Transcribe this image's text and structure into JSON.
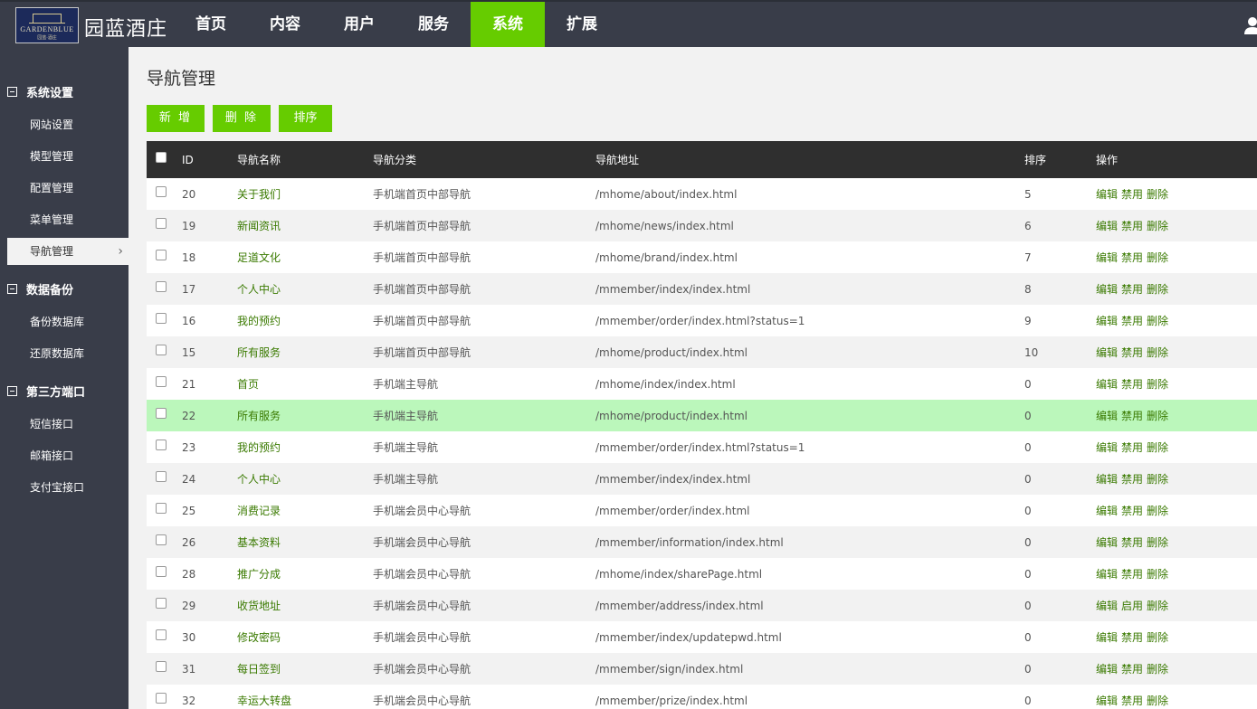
{
  "header": {
    "logo_text": "GARDENBLUE",
    "logo_sub": "园蓝·酒庄",
    "brand": "园蓝酒庄",
    "nav": [
      {
        "label": "首页",
        "active": false
      },
      {
        "label": "内容",
        "active": false
      },
      {
        "label": "用户",
        "active": false
      },
      {
        "label": "服务",
        "active": false
      },
      {
        "label": "系统",
        "active": true
      },
      {
        "label": "扩展",
        "active": false
      }
    ],
    "accent": "#66cc00"
  },
  "sidebar": {
    "groups": [
      {
        "label": "系统设置",
        "items": [
          "网站设置",
          "模型管理",
          "配置管理",
          "菜单管理",
          "导航管理"
        ]
      },
      {
        "label": "数据备份",
        "items": [
          "备份数据库",
          "还原数据库"
        ]
      },
      {
        "label": "第三方端口",
        "items": [
          "短信接口",
          "邮箱接口",
          "支付宝接口"
        ]
      }
    ],
    "active_item": "导航管理"
  },
  "main": {
    "title": "导航管理",
    "buttons": {
      "add": "新 增",
      "delete": "删 除",
      "sort": "排序"
    },
    "columns": {
      "id": "ID",
      "name": "导航名称",
      "category": "导航分类",
      "url": "导航地址",
      "sort": "排序",
      "ops": "操作"
    },
    "rows": [
      {
        "id": "20",
        "name": "关于我们",
        "category": "手机端首页中部导航",
        "url": "/mhome/about/index.html",
        "sort": "5",
        "ops": [
          "编辑",
          "禁用",
          "删除"
        ]
      },
      {
        "id": "19",
        "name": "新闻资讯",
        "category": "手机端首页中部导航",
        "url": "/mhome/news/index.html",
        "sort": "6",
        "ops": [
          "编辑",
          "禁用",
          "删除"
        ]
      },
      {
        "id": "18",
        "name": "足道文化",
        "category": "手机端首页中部导航",
        "url": "/mhome/brand/index.html",
        "sort": "7",
        "ops": [
          "编辑",
          "禁用",
          "删除"
        ]
      },
      {
        "id": "17",
        "name": "个人中心",
        "category": "手机端首页中部导航",
        "url": "/mmember/index/index.html",
        "sort": "8",
        "ops": [
          "编辑",
          "禁用",
          "删除"
        ]
      },
      {
        "id": "16",
        "name": "我的预约",
        "category": "手机端首页中部导航",
        "url": "/mmember/order/index.html?status=1",
        "sort": "9",
        "ops": [
          "编辑",
          "禁用",
          "删除"
        ]
      },
      {
        "id": "15",
        "name": "所有服务",
        "category": "手机端首页中部导航",
        "url": "/mhome/product/index.html",
        "sort": "10",
        "ops": [
          "编辑",
          "禁用",
          "删除"
        ]
      },
      {
        "id": "21",
        "name": "首页",
        "category": "手机端主导航",
        "url": "/mhome/index/index.html",
        "sort": "0",
        "ops": [
          "编辑",
          "禁用",
          "删除"
        ]
      },
      {
        "id": "22",
        "name": "所有服务",
        "category": "手机端主导航",
        "url": "/mhome/product/index.html",
        "sort": "0",
        "ops": [
          "编辑",
          "禁用",
          "删除"
        ],
        "highlighted": true
      },
      {
        "id": "23",
        "name": "我的预约",
        "category": "手机端主导航",
        "url": "/mmember/order/index.html?status=1",
        "sort": "0",
        "ops": [
          "编辑",
          "禁用",
          "删除"
        ]
      },
      {
        "id": "24",
        "name": "个人中心",
        "category": "手机端主导航",
        "url": "/mmember/index/index.html",
        "sort": "0",
        "ops": [
          "编辑",
          "禁用",
          "删除"
        ]
      },
      {
        "id": "25",
        "name": "消费记录",
        "category": "手机端会员中心导航",
        "url": "/mmember/order/index.html",
        "sort": "0",
        "ops": [
          "编辑",
          "禁用",
          "删除"
        ]
      },
      {
        "id": "26",
        "name": "基本资料",
        "category": "手机端会员中心导航",
        "url": "/mmember/information/index.html",
        "sort": "0",
        "ops": [
          "编辑",
          "禁用",
          "删除"
        ]
      },
      {
        "id": "28",
        "name": "推广分成",
        "category": "手机端会员中心导航",
        "url": "/mhome/index/sharePage.html",
        "sort": "0",
        "ops": [
          "编辑",
          "禁用",
          "删除"
        ]
      },
      {
        "id": "29",
        "name": "收货地址",
        "category": "手机端会员中心导航",
        "url": "/mmember/address/index.html",
        "sort": "0",
        "ops": [
          "编辑",
          "启用",
          "删除"
        ]
      },
      {
        "id": "30",
        "name": "修改密码",
        "category": "手机端会员中心导航",
        "url": "/mmember/index/updatepwd.html",
        "sort": "0",
        "ops": [
          "编辑",
          "禁用",
          "删除"
        ]
      },
      {
        "id": "31",
        "name": "每日签到",
        "category": "手机端会员中心导航",
        "url": "/mmember/sign/index.html",
        "sort": "0",
        "ops": [
          "编辑",
          "禁用",
          "删除"
        ]
      },
      {
        "id": "32",
        "name": "幸运大转盘",
        "category": "手机端会员中心导航",
        "url": "/mmember/prize/index.html",
        "sort": "0",
        "ops": [
          "编辑",
          "禁用",
          "删除"
        ]
      }
    ]
  }
}
